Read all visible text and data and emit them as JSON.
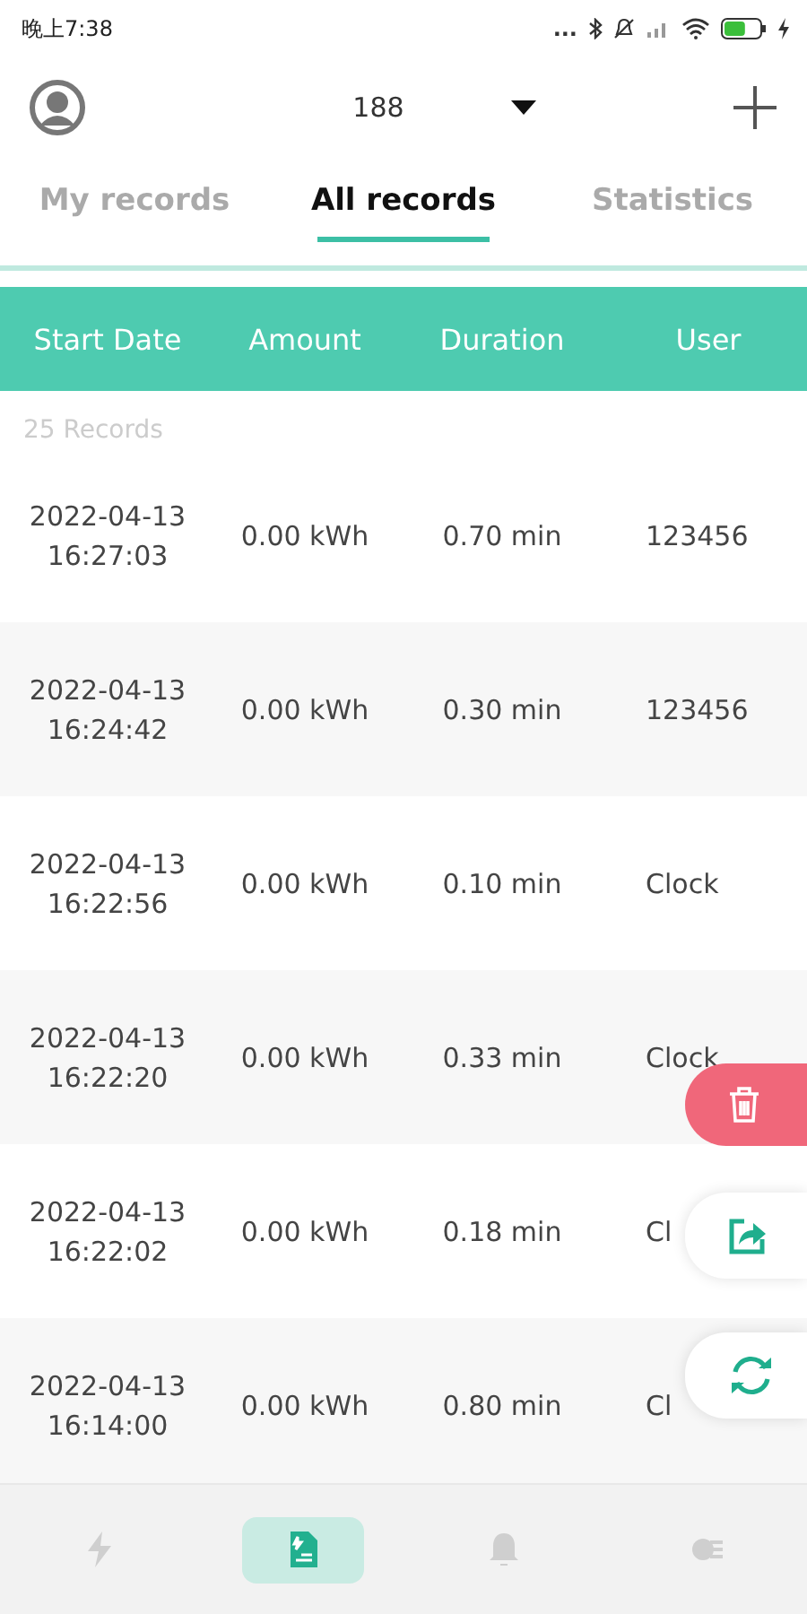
{
  "status_bar": {
    "time": "晚上7:38",
    "more": "..."
  },
  "header": {
    "selector": "188"
  },
  "tabs": [
    {
      "label": "My records",
      "selected": false
    },
    {
      "label": "All records",
      "selected": true
    },
    {
      "label": "Statistics",
      "selected": false
    }
  ],
  "table": {
    "columns": [
      "Start Date",
      "Amount",
      "Duration",
      "User"
    ],
    "count": "25 Records",
    "rows": [
      {
        "date": "2022-04-13",
        "time": "16:27:03",
        "amount": "0.00 kWh",
        "duration": "0.70 min",
        "user": "123456"
      },
      {
        "date": "2022-04-13",
        "time": "16:24:42",
        "amount": "0.00 kWh",
        "duration": "0.30 min",
        "user": "123456"
      },
      {
        "date": "2022-04-13",
        "time": "16:22:56",
        "amount": "0.00 kWh",
        "duration": "0.10 min",
        "user": "Clock"
      },
      {
        "date": "2022-04-13",
        "time": "16:22:20",
        "amount": "0.00 kWh",
        "duration": "0.33 min",
        "user": "Clock"
      },
      {
        "date": "2022-04-13",
        "time": "16:22:02",
        "amount": "0.00 kWh",
        "duration": "0.18 min",
        "user": "Cl"
      },
      {
        "date": "2022-04-13",
        "time": "16:14:00",
        "amount": "0.00 kWh",
        "duration": "0.80 min",
        "user": "Cl"
      }
    ]
  },
  "bottom_nav": [
    {
      "selected": false
    },
    {
      "selected": true
    },
    {
      "selected": false
    },
    {
      "selected": false
    }
  ]
}
